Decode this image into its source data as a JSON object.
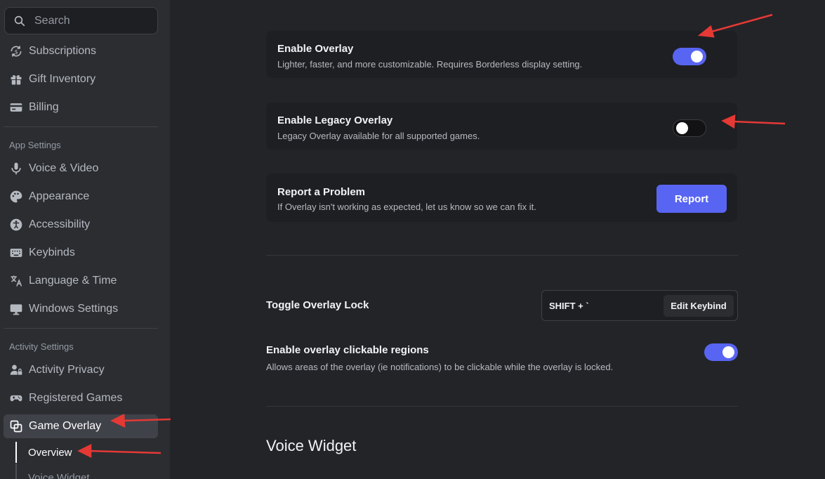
{
  "sidebar": {
    "search_placeholder": "Search",
    "top_items": [
      {
        "label": "Subscriptions",
        "icon": "subscriptions-icon"
      },
      {
        "label": "Gift Inventory",
        "icon": "gift-icon"
      },
      {
        "label": "Billing",
        "icon": "billing-card-icon"
      }
    ],
    "app_settings_label": "App Settings",
    "app_items": [
      {
        "label": "Voice & Video",
        "icon": "microphone-icon"
      },
      {
        "label": "Appearance",
        "icon": "palette-icon"
      },
      {
        "label": "Accessibility",
        "icon": "accessibility-icon"
      },
      {
        "label": "Keybinds",
        "icon": "keyboard-icon"
      },
      {
        "label": "Language & Time",
        "icon": "translate-icon"
      },
      {
        "label": "Windows Settings",
        "icon": "monitor-icon"
      }
    ],
    "activity_settings_label": "Activity Settings",
    "activity_items": [
      {
        "label": "Activity Privacy",
        "icon": "person-lock-icon"
      },
      {
        "label": "Registered Games",
        "icon": "gamepad-icon"
      },
      {
        "label": "Game Overlay",
        "icon": "overlay-icon"
      }
    ],
    "sub_items": [
      {
        "label": "Overview"
      },
      {
        "label": "Voice Widget"
      }
    ]
  },
  "main": {
    "enable_overlay": {
      "title": "Enable Overlay",
      "description": "Lighter, faster, and more customizable. Requires Borderless display setting.",
      "enabled": true
    },
    "legacy_overlay": {
      "title": "Enable Legacy Overlay",
      "description": "Legacy Overlay available for all supported games.",
      "enabled": false
    },
    "report_problem": {
      "title": "Report a Problem",
      "description": "If Overlay isn't working as expected, let us know so we can fix it.",
      "button_label": "Report"
    },
    "toggle_lock": {
      "title": "Toggle Overlay Lock",
      "keys": "SHIFT + `",
      "edit_label": "Edit Keybind"
    },
    "clickable_regions": {
      "title": "Enable overlay clickable regions",
      "description": "Allows areas of the overlay (ie notifications) to be clickable while the overlay is locked.",
      "enabled": true
    },
    "voice_widget_heading": "Voice Widget"
  },
  "colors": {
    "accent": "#5865f2",
    "annotation_arrow": "#e53935"
  }
}
